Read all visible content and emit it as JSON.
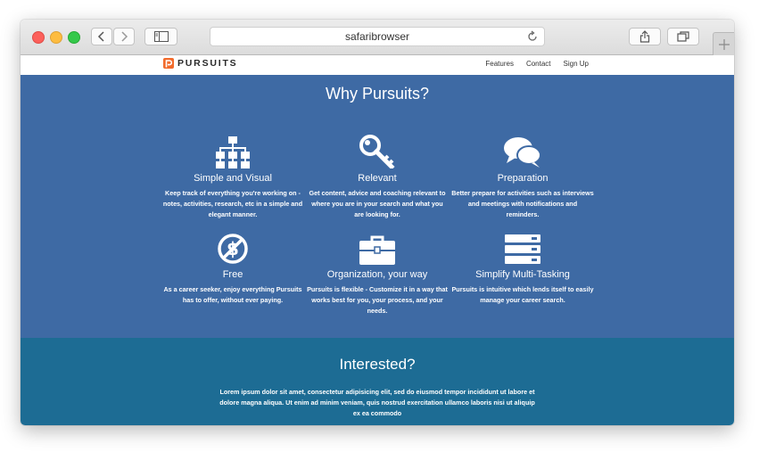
{
  "browser": {
    "address": "safaribrowser"
  },
  "nav": {
    "logo_text": "PURSUITS",
    "links": [
      "Features",
      "Contact",
      "Sign Up"
    ]
  },
  "why": {
    "title": "Why Pursuits?",
    "features": [
      {
        "icon": "sitemap-icon",
        "title": "Simple and Visual",
        "desc": "Keep track of everything you're working on - notes, activities, research, etc in a simple and elegant manner."
      },
      {
        "icon": "key-icon",
        "title": "Relevant",
        "desc": "Get content, advice and coaching relevant to where you are in your search and what you are looking for."
      },
      {
        "icon": "chat-bubbles-icon",
        "title": "Preparation",
        "desc": "Better prepare for activities such as interviews and meetings with notifications and reminders."
      },
      {
        "icon": "no-dollar-icon",
        "title": "Free",
        "desc": "As a career seeker, enjoy everything Pursuits has to offer, without ever paying."
      },
      {
        "icon": "briefcase-icon",
        "title": "Organization, your way",
        "desc": "Pursuits is flexible - Customize it in a way that works best for you, your process, and your needs."
      },
      {
        "icon": "server-stack-icon",
        "title": "Simplify Multi-Tasking",
        "desc": "Pursuits is intuitive which lends itself to easily manage your career search."
      }
    ]
  },
  "interested": {
    "title": "Interested?",
    "text": "Lorem ipsum dolor sit amet, consectetur adipisicing elit, sed do eiusmod tempor incididunt ut labore et dolore magna aliqua. Ut enim ad minim veniam, quis nostrud exercitation ullamco laboris nisi ut aliquip ex ea commodo"
  },
  "colors": {
    "why_bg": "#3e6aa4",
    "interested_bg": "#1d6c94",
    "logo_accent": "#f26b2c"
  }
}
